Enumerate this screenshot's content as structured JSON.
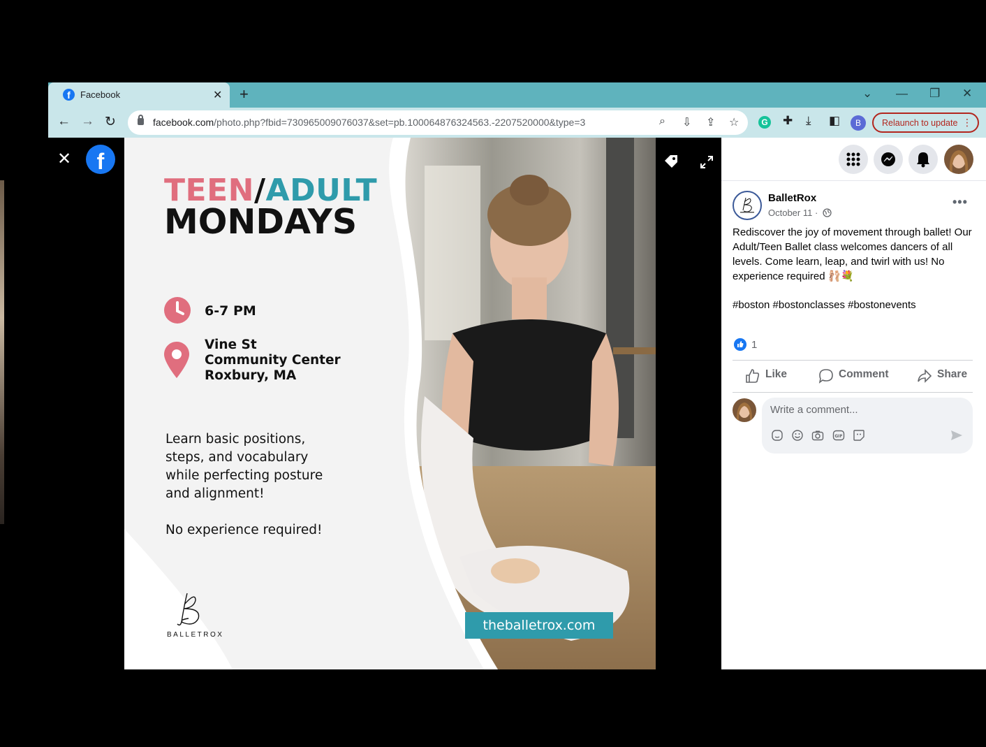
{
  "browser": {
    "tab_title": "Facebook",
    "url_host": "facebook.com",
    "url_path": "/photo.php?fbid=730965009076037&set=pb.100064876324563.-2207520000&type=3",
    "profile_initial": "B",
    "relaunch_label": "Relaunch to update"
  },
  "flyer": {
    "headline_teen": "TEEN",
    "headline_slash": "/",
    "headline_adult": "ADULT",
    "headline_day": "MONDAYS",
    "time": "6-7 PM",
    "location": [
      "Vine St",
      "Community Center",
      "Roxbury, MA"
    ],
    "description": [
      "Learn basic positions,",
      "steps, and vocabulary",
      "while perfecting posture",
      "and alignment!"
    ],
    "no_experience": "No experience required!",
    "logo_text": "BALLETROX",
    "website": "theballetrox.com",
    "colors": {
      "pink": "#e06e7e",
      "teal": "#2f9bab"
    }
  },
  "post": {
    "page_name": "BalletRox",
    "date": "October 11 ·",
    "text": "Rediscover the joy of movement through ballet! Our Adult/Teen Ballet class welcomes dancers of all levels. Come learn, leap, and twirl with us! No experience required 🩰💐",
    "hashtags": "#boston #bostonclasses #bostonevents",
    "like_count": "1",
    "actions": {
      "like": "Like",
      "comment": "Comment",
      "share": "Share"
    },
    "comment_placeholder": "Write a comment..."
  }
}
